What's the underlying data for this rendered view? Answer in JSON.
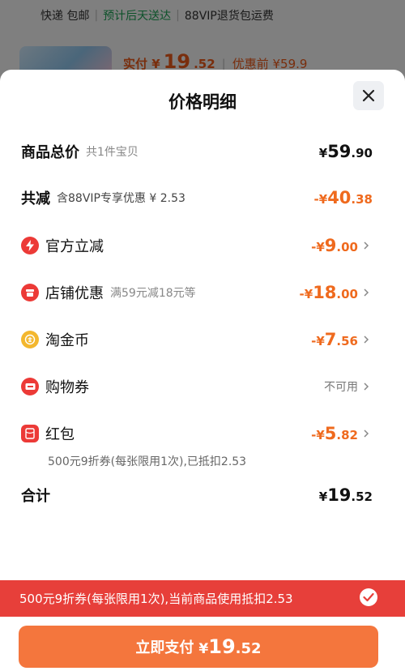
{
  "background": {
    "shipping": {
      "express": "快递 包邮",
      "eta": "预计后天送达",
      "return_note": "88VIP退货包运费"
    },
    "pay_label": "实付 ¥",
    "pay_int": "19",
    "pay_dec": ".52",
    "orig_label": "优惠前 ¥59.9"
  },
  "sheet": {
    "title": "价格明细",
    "total": {
      "label": "商品总价",
      "sub": "共1件宝贝",
      "yen": "¥",
      "int": "59",
      "dec": ".90"
    },
    "reduce": {
      "label": "共减",
      "sub": "含88VIP专享优惠 ¥ 2.53",
      "yen": "-¥",
      "int": "40",
      "dec": ".38"
    },
    "official": {
      "label": "官方立减",
      "yen": "-¥",
      "int": "9",
      "dec": ".00"
    },
    "store": {
      "label": "店铺优惠",
      "sub": "满59元减18元等",
      "yen": "-¥",
      "int": "18",
      "dec": ".00"
    },
    "coin": {
      "label": "淘金币",
      "yen": "-¥",
      "int": "7",
      "dec": ".56"
    },
    "voucher": {
      "label": "购物券",
      "status": "不可用"
    },
    "redpacket": {
      "label": "红包",
      "yen": "-¥",
      "int": "5",
      "dec": ".82",
      "note": "500元9折券(每张限用1次),已抵扣2.53"
    },
    "sum": {
      "label": "合计",
      "yen": "¥",
      "int": "19",
      "dec": ".52"
    }
  },
  "coupon_bar": {
    "text": "500元9折券(每张限用1次),当前商品使用抵扣2.53"
  },
  "pay_button": {
    "label": "立即支付",
    "yen": "¥",
    "int": "19",
    "dec": ".52"
  },
  "colors": {
    "accent": "#ef6a1e",
    "red": "#e73f3a",
    "button": "#f4763d"
  }
}
